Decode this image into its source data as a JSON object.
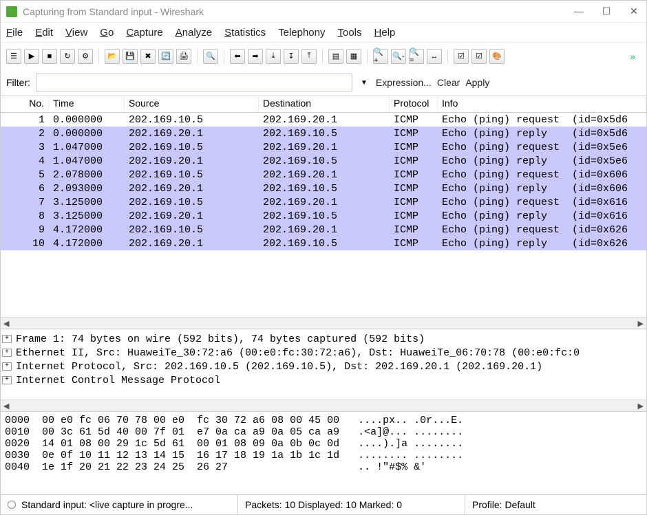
{
  "window": {
    "title": "Capturing from Standard input - Wireshark"
  },
  "menubar": [
    {
      "label": "File",
      "key": "F"
    },
    {
      "label": "Edit",
      "key": "E"
    },
    {
      "label": "View",
      "key": "V"
    },
    {
      "label": "Go",
      "key": "G"
    },
    {
      "label": "Capture",
      "key": "C"
    },
    {
      "label": "Analyze",
      "key": "A"
    },
    {
      "label": "Statistics",
      "key": "S"
    },
    {
      "label": "Telephony",
      "key": "-"
    },
    {
      "label": "Tools",
      "key": "T"
    },
    {
      "label": "Help",
      "key": "H"
    }
  ],
  "toolbar": {
    "icons": [
      "list",
      "capture-start",
      "capture-stop",
      "capture-restart",
      "capture-options",
      "open",
      "save",
      "close",
      "reload",
      "print",
      "find",
      "go-back",
      "go-forward",
      "go-last",
      "go-to",
      "go-first",
      "colorize",
      "auto-scroll",
      "zoom-in",
      "zoom-out",
      "zoom-fit",
      "resize-cols",
      "capture-filters",
      "display-filters",
      "coloring-rules"
    ]
  },
  "filter": {
    "label": "Filter:",
    "value": "",
    "expression": "Expression...",
    "clear": "Clear",
    "apply": "Apply"
  },
  "packet_columns": [
    "No.",
    "Time",
    "Source",
    "Destination",
    "Protocol",
    "Info"
  ],
  "packets": [
    {
      "no": "1",
      "time": "0.000000",
      "src": "202.169.10.5",
      "dst": "202.169.20.1",
      "proto": "ICMP",
      "info": "Echo (ping) request  (id=0x5d6"
    },
    {
      "no": "2",
      "time": "0.000000",
      "src": "202.169.20.1",
      "dst": "202.169.10.5",
      "proto": "ICMP",
      "info": "Echo (ping) reply    (id=0x5d6"
    },
    {
      "no": "3",
      "time": "1.047000",
      "src": "202.169.10.5",
      "dst": "202.169.20.1",
      "proto": "ICMP",
      "info": "Echo (ping) request  (id=0x5e6"
    },
    {
      "no": "4",
      "time": "1.047000",
      "src": "202.169.20.1",
      "dst": "202.169.10.5",
      "proto": "ICMP",
      "info": "Echo (ping) reply    (id=0x5e6"
    },
    {
      "no": "5",
      "time": "2.078000",
      "src": "202.169.10.5",
      "dst": "202.169.20.1",
      "proto": "ICMP",
      "info": "Echo (ping) request  (id=0x606"
    },
    {
      "no": "6",
      "time": "2.093000",
      "src": "202.169.20.1",
      "dst": "202.169.10.5",
      "proto": "ICMP",
      "info": "Echo (ping) reply    (id=0x606"
    },
    {
      "no": "7",
      "time": "3.125000",
      "src": "202.169.10.5",
      "dst": "202.169.20.1",
      "proto": "ICMP",
      "info": "Echo (ping) request  (id=0x616"
    },
    {
      "no": "8",
      "time": "3.125000",
      "src": "202.169.20.1",
      "dst": "202.169.10.5",
      "proto": "ICMP",
      "info": "Echo (ping) reply    (id=0x616"
    },
    {
      "no": "9",
      "time": "4.172000",
      "src": "202.169.10.5",
      "dst": "202.169.20.1",
      "proto": "ICMP",
      "info": "Echo (ping) request  (id=0x626"
    },
    {
      "no": "10",
      "time": "4.172000",
      "src": "202.169.20.1",
      "dst": "202.169.10.5",
      "proto": "ICMP",
      "info": "Echo (ping) reply    (id=0x626"
    }
  ],
  "detail_tree": [
    "Frame 1: 74 bytes on wire (592 bits), 74 bytes captured (592 bits)",
    "Ethernet II, Src: HuaweiTe_30:72:a6 (00:e0:fc:30:72:a6), Dst: HuaweiTe_06:70:78 (00:e0:fc:0",
    "Internet Protocol, Src: 202.169.10.5 (202.169.10.5), Dst: 202.169.20.1 (202.169.20.1)",
    "Internet Control Message Protocol"
  ],
  "bytes": [
    "0000  00 e0 fc 06 70 78 00 e0  fc 30 72 a6 08 00 45 00   ....px.. .0r...E.",
    "0010  00 3c 61 5d 40 00 7f 01  e7 0a ca a9 0a 05 ca a9   .<a]@... ........",
    "0020  14 01 08 00 29 1c 5d 61  00 01 08 09 0a 0b 0c 0d   ....).]a ........",
    "0030  0e 0f 10 11 12 13 14 15  16 17 18 19 1a 1b 1c 1d   ........ ........",
    "0040  1e 1f 20 21 22 23 24 25  26 27                     .. !\"#$% &'"
  ],
  "statusbar": {
    "left": "Standard input: <live capture in progre...",
    "mid": "Packets: 10 Displayed: 10 Marked: 0",
    "right": "Profile: Default"
  }
}
